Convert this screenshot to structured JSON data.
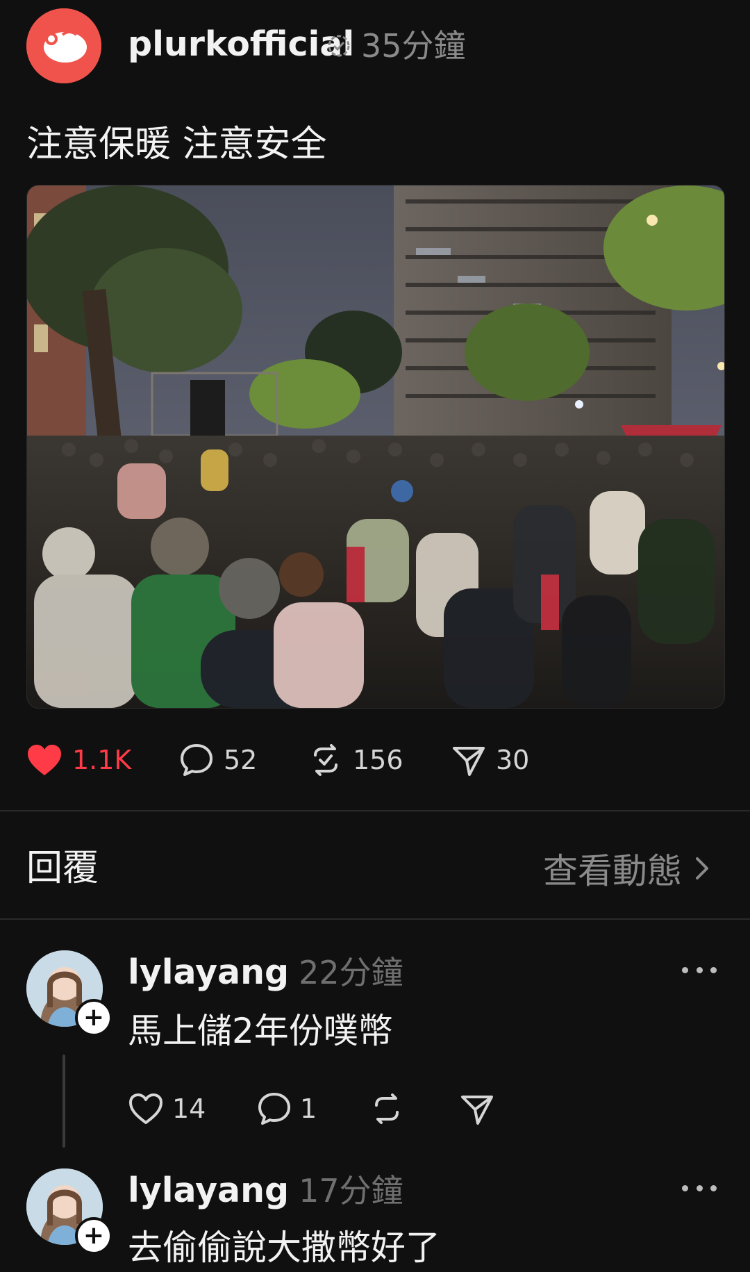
{
  "post": {
    "username": "plurkofficial",
    "time": "35分鐘",
    "text": "注意保暖 注意安全",
    "likes": "1.1K",
    "comments": "52",
    "replurks": "156",
    "shares": "30"
  },
  "replies": {
    "title": "回覆",
    "activity_label": "查看動態"
  },
  "comments": [
    {
      "username": "lylayang",
      "time": "22分鐘",
      "text": "馬上儲2年份噗幣",
      "likes": "14",
      "replies": "1"
    },
    {
      "username": "lylayang",
      "time": "17分鐘",
      "text": "去偷偷說大撒幣好了"
    }
  ],
  "colors": {
    "background": "#101010",
    "like_red": "#ff3b47",
    "avatar_brand": "#f0534b",
    "muted_text": "#8a8a8a"
  },
  "icons": [
    "heart-filled-icon",
    "comment-icon",
    "replurk-icon",
    "share-icon",
    "verified-icon",
    "chevron-right-icon",
    "more-options-icon",
    "follow-plus-icon"
  ]
}
